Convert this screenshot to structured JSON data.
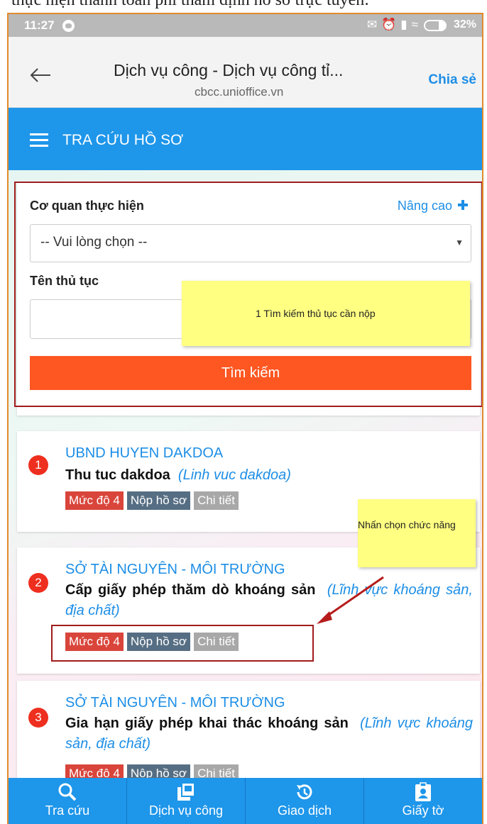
{
  "caption": "thực hiện thanh toán phí thẩm định hồ sơ trực tuyến:",
  "status_bar": {
    "time": "11:27",
    "battery": "32%",
    "battery_level": 0.32
  },
  "browser": {
    "title": "Dịch vụ công - Dịch vụ công tỉ...",
    "url": "cbcc.unioffice.vn",
    "share": "Chia sẻ"
  },
  "header": {
    "title": "TRA CỨU HỒ SƠ"
  },
  "search": {
    "agency_label": "Cơ quan thực hiện",
    "advanced": "Nâng cao",
    "agency_value": "-- Vui lòng chọn --",
    "procedure_label": "Tên thủ tục",
    "procedure_value": "",
    "button": "Tìm kiếm"
  },
  "notes": {
    "search_note": "1 Tìm kiếm thủ tục cần nộp",
    "select_note": "Nhấn chọn chức năng"
  },
  "procedures": [
    {
      "number": "1",
      "agency": "UBND HUYEN DAKDOA",
      "name": "Thu tuc dakdoa",
      "field": "(Linh vuc dakdoa)",
      "level": "Mức độ 4",
      "submit": "Nộp hồ sơ",
      "detail": "Chi tiết"
    },
    {
      "number": "2",
      "agency": "SỞ TÀI NGUYÊN - MÔI TRƯỜNG",
      "name": "Cấp giấy phép thăm dò khoáng sản",
      "field": "(Lĩnh vực khoáng sản, địa chất)",
      "level": "Mức độ 4",
      "submit": "Nộp hồ sơ",
      "detail": "Chi tiết"
    },
    {
      "number": "3",
      "agency": "SỞ TÀI NGUYÊN - MÔI TRƯỜNG",
      "name": "Gia hạn giấy phép khai thác khoáng sản",
      "field": "(Lĩnh vực khoáng sản, địa chất)",
      "level": "Mức độ 4",
      "submit": "Nộp hồ sơ",
      "detail": "Chi tiết"
    }
  ],
  "bottom_nav": [
    {
      "label": "Tra cứu",
      "icon": "search-icon"
    },
    {
      "label": "Dịch vụ công",
      "icon": "documents-icon"
    },
    {
      "label": "Giao dịch",
      "icon": "history-icon"
    },
    {
      "label": "Giấy tờ",
      "icon": "id-badge-icon"
    }
  ],
  "colors": {
    "primary": "#1e96ea",
    "accent": "#fe5722",
    "badge": "#ee2f1f",
    "link": "#1d8ee6"
  }
}
